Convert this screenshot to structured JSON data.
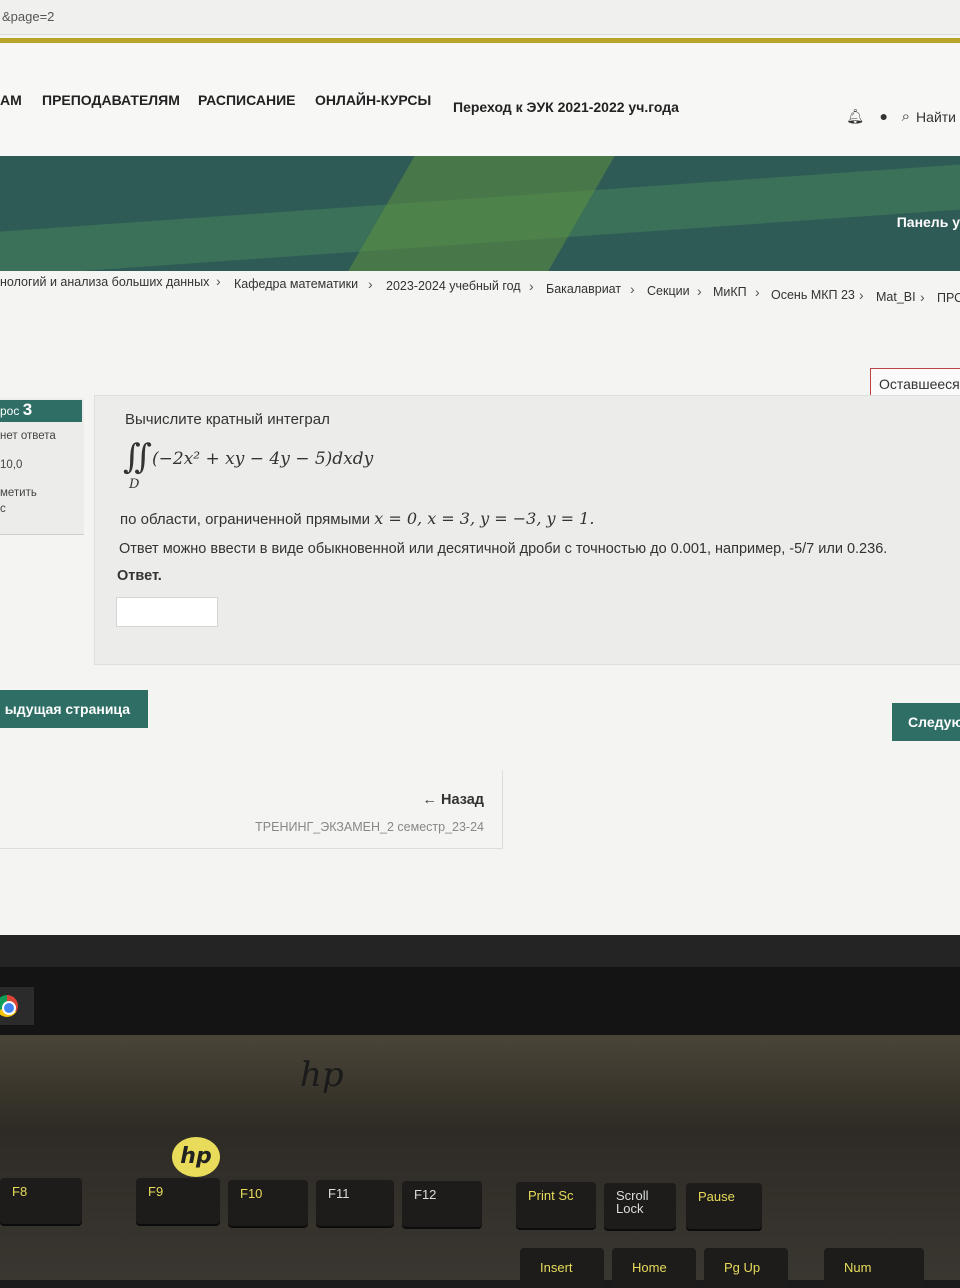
{
  "address_bar": {
    "url_fragment": "&page=2"
  },
  "nav": {
    "items": [
      "АМ",
      "ПРЕПОДАВАТЕЛЯМ",
      "РАСПИСАНИЕ",
      "ОНЛАЙН-КУРСЫ",
      "Переход к ЭУК 2021-2022 уч.года"
    ],
    "search_label": "Найти",
    "icons": [
      "bell-icon",
      "chat-icon",
      "search-icon"
    ]
  },
  "banner": {
    "panel_label": "Панель у"
  },
  "breadcrumbs": [
    "нологий и анализа больших данных",
    "Кафедра математики",
    "2023-2024 учебный год",
    "Бакалавриат",
    "Секции",
    "МиКП",
    "Осень МКП 23",
    "Mat_BI",
    "ПРС"
  ],
  "timer": {
    "label": "Оставшееся"
  },
  "question_info": {
    "number_prefix": "рос",
    "number": "3",
    "status": "нет ответа",
    "score": "10,0",
    "flag": "метить",
    "extra": "с"
  },
  "question": {
    "prompt": "Вычислите кратный интеграл",
    "integral_symbol": "∬",
    "domain_label": "D",
    "integrand": "(−2x² + xy − 4y − 5)dxdy",
    "region_text": "по области, ограниченной прямыми",
    "region_math": "x = 0, x = 3, y = −3, y = 1.",
    "instruction": "Ответ можно ввести  в виде обыкновенной или десятичной дроби с точностью до 0.001, например, -5/7 или 0.236.",
    "answer_label": "Ответ.",
    "answer_value": ""
  },
  "buttons": {
    "prev": "ыдущая страница",
    "next": "Следую"
  },
  "back": {
    "label": "← Назад",
    "course": "ТРЕНИНГ_ЭКЗАМЕН_2 семестр_23-24"
  },
  "laptop": {
    "keys_row1": [
      "F8",
      "F9",
      "F10",
      "F11",
      "F12",
      "Print Sc",
      "Scroll Lock",
      "Pause"
    ],
    "keys_row2": [
      "Insert",
      "Home",
      "Pg Up",
      "Num"
    ]
  },
  "colors": {
    "accent": "#2e6e64",
    "banner": "#2f5b56",
    "gold": "#b9a42a"
  }
}
